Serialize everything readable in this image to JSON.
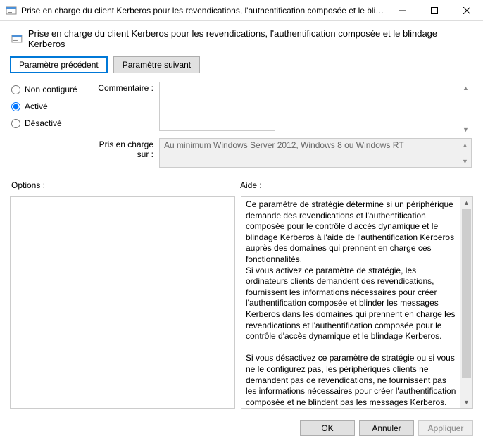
{
  "titlebar": {
    "text": "Prise en charge du client Kerberos pour les revendications, l'authentification composée et le blin..."
  },
  "header": {
    "text": "Prise en charge du client Kerberos pour les revendications, l'authentification composée et le blindage Kerberos"
  },
  "nav": {
    "prev": "Paramètre précédent",
    "next": "Paramètre suivant"
  },
  "radios": {
    "not_configured": "Non configuré",
    "enabled": "Activé",
    "disabled": "Désactivé"
  },
  "labels": {
    "comment": "Commentaire :",
    "supported": "Pris en charge sur :",
    "options": "Options :",
    "help": "Aide :"
  },
  "supported": {
    "text": "Au minimum Windows Server 2012, Windows 8 ou Windows RT"
  },
  "help": {
    "para1": "Ce paramètre de stratégie détermine si un périphérique demande des revendications et l'authentification composée pour le contrôle d'accès dynamique et le blindage Kerberos à l'aide de l'authentification Kerberos auprès des domaines qui prennent en charge ces fonctionnalités.",
    "para2": "Si vous activez ce paramètre de stratégie, les ordinateurs clients demandent des revendications, fournissent les informations nécessaires pour créer l'authentification composée et blinder les messages Kerberos dans les domaines qui prennent en charge les revendications et l'authentification composée pour le contrôle d'accès dynamique et le blindage Kerberos.",
    "para3": "Si vous désactivez ce paramètre de stratégie ou si vous ne le configurez pas, les périphériques clients ne demandent pas de revendications, ne fournissent pas les informations nécessaires pour créer l'authentification composée et ne blindent pas les messages Kerberos. Les services hébergés sur le périphérique ne sont alors pas en mesure de récupérer les revendications des clients qui utilisent la transition du protocole Kerberos."
  },
  "footer": {
    "ok": "OK",
    "cancel": "Annuler",
    "apply": "Appliquer"
  }
}
